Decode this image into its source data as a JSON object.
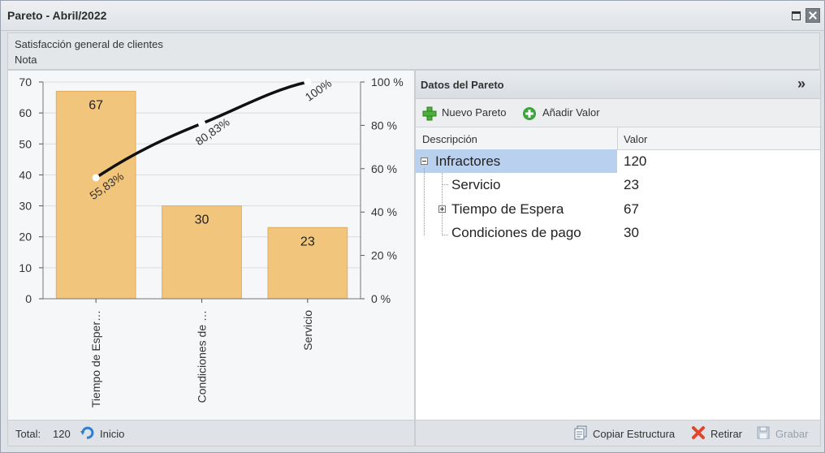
{
  "window": {
    "title": "Pareto - Abril/2022"
  },
  "header": {
    "subtitle": "Satisfacción general de clientes",
    "note": "Nota"
  },
  "chart_data": {
    "type": "bar",
    "categories": [
      "Tiempo de Esper…",
      "Condiciones de …",
      "Servicio"
    ],
    "values": [
      67,
      30,
      23
    ],
    "bar_labels": [
      "67",
      "30",
      "23"
    ],
    "cumulative_percent": [
      55.83,
      80.83,
      100
    ],
    "cumulative_labels": [
      "55,83%",
      "80,83%",
      "100%"
    ],
    "ylim": [
      0,
      70
    ],
    "y_ticks": [
      "0",
      "10",
      "20",
      "30",
      "40",
      "50",
      "60",
      "70"
    ],
    "y2_ticks": [
      "0 %",
      "20 %",
      "40 %",
      "60 %",
      "80 %",
      "100 %"
    ],
    "colors": {
      "bar": "#f2c57c",
      "bar_border": "#e0ad5e",
      "line": "#111111",
      "grid": "#d9dcdf"
    },
    "grid": true
  },
  "footer_left": {
    "total_label": "Total:",
    "total_value": "120",
    "inicio_label": "Inicio"
  },
  "data_panel": {
    "title": "Datos del Pareto",
    "toolbar": {
      "new_label": "Nuevo Pareto",
      "add_label": "Añadir Valor"
    },
    "columns": [
      "Descripción",
      "Valor"
    ],
    "rows": [
      {
        "desc": "Infractores",
        "value": "120"
      },
      {
        "desc": "Servicio",
        "value": "23"
      },
      {
        "desc": "Tiempo de Espera",
        "value": "67"
      },
      {
        "desc": "Condiciones de pago",
        "value": "30"
      }
    ]
  },
  "footer_right": {
    "copy_label": "Copiar Estructura",
    "remove_label": "Retirar",
    "save_label": "Grabar"
  }
}
